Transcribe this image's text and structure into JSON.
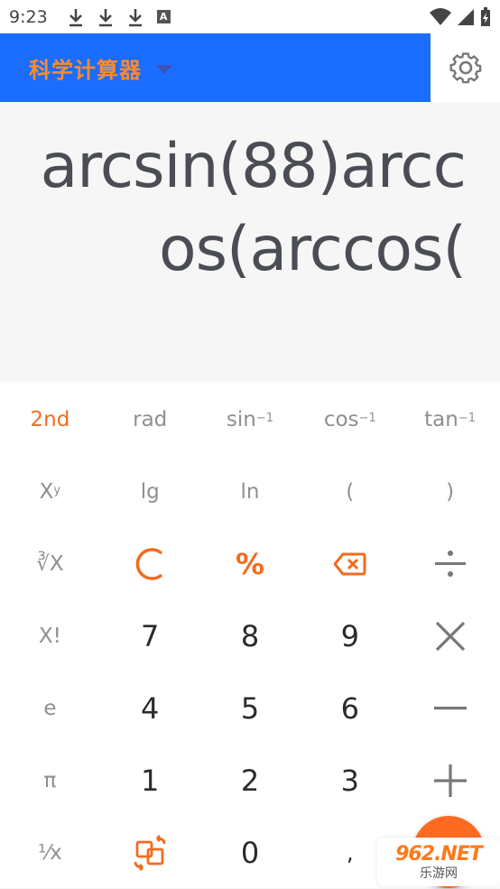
{
  "status_bar": {
    "time": "9:23",
    "notif_letter": "A"
  },
  "app_bar": {
    "title": "科学计算器"
  },
  "display": {
    "line1": "arcsin(88)arcc",
    "line2": "os(arccos("
  },
  "keypad": {
    "row1": [
      {
        "label": "2nd",
        "sup": ""
      },
      {
        "label": "rad",
        "sup": ""
      },
      {
        "label": "sin",
        "sup": "−1"
      },
      {
        "label": "cos",
        "sup": "−1"
      },
      {
        "label": "tan",
        "sup": "−1"
      }
    ],
    "row2": [
      {
        "label": "X",
        "sup": "y"
      },
      {
        "label": "lg",
        "sup": ""
      },
      {
        "label": "ln",
        "sup": ""
      },
      {
        "label": "(",
        "sup": ""
      },
      {
        "label": ")",
        "sup": ""
      }
    ],
    "row3": [
      "∛X",
      "C",
      "%"
    ],
    "row4": [
      "X!",
      "7",
      "8",
      "9"
    ],
    "row5": [
      "e",
      "4",
      "5",
      "6"
    ],
    "row6": [
      "π",
      "1",
      "2",
      "3"
    ],
    "row7": [
      "¹⁄x",
      "0",
      ","
    ]
  },
  "watermark": {
    "logo": "962.NET",
    "site": "乐游网"
  },
  "colors": {
    "appbar": "#1b6dff",
    "accent": "#f26b1f",
    "title": "#ff8a2b"
  }
}
